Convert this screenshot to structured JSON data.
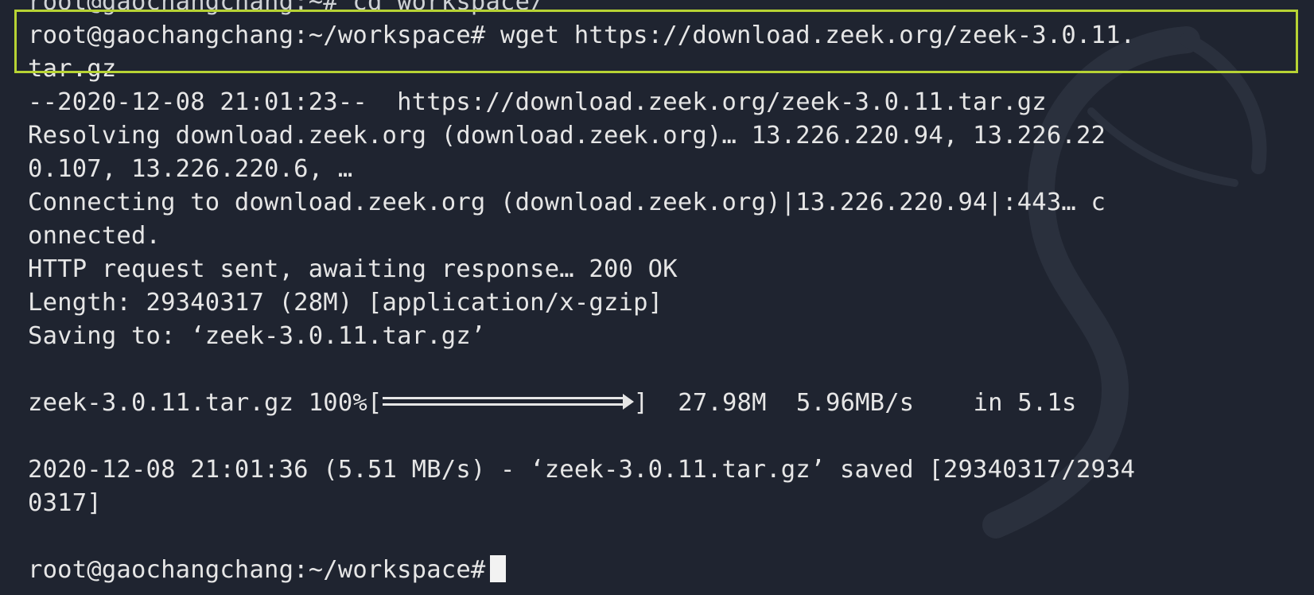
{
  "terminal": {
    "lines": {
      "prev_command": "root@gaochangchang:~# cd workspace/",
      "cmd_line1": "root@gaochangchang:~/workspace# wget https://download.zeek.org/zeek-3.0.11.",
      "cmd_line2": "tar.gz",
      "start": "--2020-12-08 21:01:23--  https://download.zeek.org/zeek-3.0.11.tar.gz",
      "resolving1": "Resolving download.zeek.org (download.zeek.org)… 13.226.220.94, 13.226.22",
      "resolving2": "0.107, 13.226.220.6, …",
      "connecting1": "Connecting to download.zeek.org (download.zeek.org)|13.226.220.94|:443… c",
      "connecting2": "onnected.",
      "http": "HTTP request sent, awaiting response… 200 OK",
      "length": "Length: 29340317 (28M) [application/x-gzip]",
      "saving": "Saving to: ‘zeek-3.0.11.tar.gz’",
      "saved1": "2020-12-08 21:01:36 (5.51 MB/s) - ‘zeek-3.0.11.tar.gz’ saved [29340317/2934",
      "saved2": "0317]",
      "prompt": "root@gaochangchang:~/workspace#"
    },
    "progress": {
      "filename": "zeek-3.0.11.tar.gz",
      "percent_label": "100%",
      "percent": 100,
      "open_bracket": "[",
      "close_bracket": "]",
      "size": "27.98M",
      "speed": "5.96MB/s",
      "time": "in 5.1s"
    }
  },
  "colors": {
    "background": "#1f2430",
    "text": "#e6e6e6",
    "highlight_border": "#b7d334"
  },
  "icons": {
    "watermark": "kali-dragon-icon",
    "cursor": "block-cursor"
  }
}
